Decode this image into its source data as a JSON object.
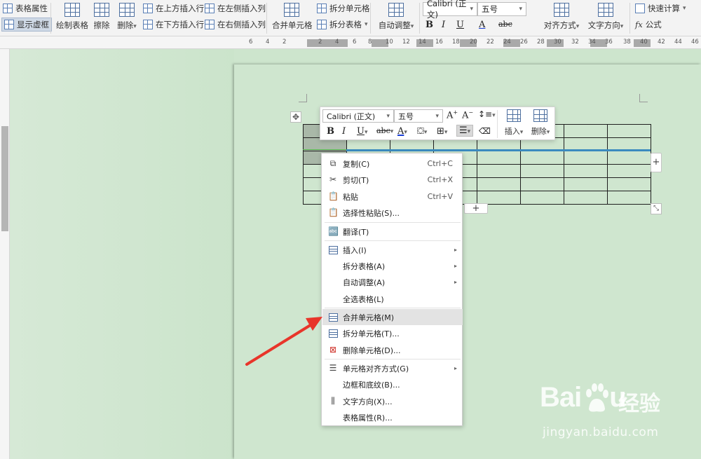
{
  "ribbon": {
    "table_properties": "表格属性",
    "show_gridlines": "显示虚框",
    "draw_table": "绘制表格",
    "eraser": "擦除",
    "delete": "删除",
    "insert_row_above": "在上方插入行",
    "insert_row_below": "在下方插入行",
    "insert_col_left": "在左侧插入列",
    "insert_col_right": "在右侧插入列",
    "merge_cells": "合并单元格",
    "split_cells": "拆分单元格",
    "split_table": "拆分表格",
    "auto_fit": "自动调整",
    "font_name": "Calibri (正文)",
    "font_size": "五号",
    "align": "对齐方式",
    "text_direction": "文字方向",
    "quick_calc": "快速计算",
    "formula": "公式",
    "bold": "B",
    "italic": "I",
    "underline": "U",
    "font_color": "A",
    "strikethrough": "abc"
  },
  "ruler": {
    "numbers": [
      "6",
      "4",
      "2",
      "2",
      "4",
      "6",
      "8",
      "10",
      "12",
      "14",
      "16",
      "18",
      "20",
      "22",
      "24",
      "26",
      "28",
      "30",
      "32",
      "34",
      "36",
      "38",
      "40",
      "42",
      "44",
      "46"
    ]
  },
  "mini_toolbar": {
    "font_name": "Calibri (正文)",
    "font_size": "五号",
    "grow_font": "A",
    "shrink_font": "A",
    "bold": "B",
    "italic": "I",
    "underline": "U",
    "strike": "abc",
    "font_color": "A",
    "insert": "插入",
    "delete": "删除"
  },
  "context_menu": {
    "items": [
      {
        "label": "复制(C)",
        "shortcut": "Ctrl+C",
        "icon": "copy-icon"
      },
      {
        "label": "剪切(T)",
        "shortcut": "Ctrl+X",
        "icon": "cut-icon"
      },
      {
        "label": "粘贴",
        "shortcut": "Ctrl+V",
        "icon": "paste-icon"
      },
      {
        "label": "选择性粘贴(S)...",
        "shortcut": "",
        "icon": "paste-special-icon"
      },
      {
        "label": "翻译(T)",
        "shortcut": "",
        "icon": "translate-icon"
      },
      {
        "label": "插入(I)",
        "shortcut": "",
        "icon": "insert-table-icon"
      },
      {
        "label": "拆分表格(A)",
        "shortcut": "",
        "icon": ""
      },
      {
        "label": "自动调整(A)",
        "shortcut": "",
        "icon": ""
      },
      {
        "label": "全选表格(L)",
        "shortcut": "",
        "icon": ""
      },
      {
        "label": "合并单元格(M)",
        "shortcut": "",
        "icon": "merge-cells-icon"
      },
      {
        "label": "拆分单元格(T)...",
        "shortcut": "",
        "icon": "split-cells-icon"
      },
      {
        "label": "删除单元格(D)...",
        "shortcut": "",
        "icon": "delete-cells-icon"
      },
      {
        "label": "单元格对齐方式(G)",
        "shortcut": "",
        "icon": "cell-align-icon"
      },
      {
        "label": "边框和底纹(B)...",
        "shortcut": "",
        "icon": ""
      },
      {
        "label": "文字方向(X)...",
        "shortcut": "",
        "icon": "text-direction-icon"
      },
      {
        "label": "表格属性(R)...",
        "shortcut": "",
        "icon": ""
      }
    ],
    "highlighted": "合并单元格(M)"
  },
  "watermark": {
    "brand": "Bai",
    "brand_tail": "u",
    "cn": "经验",
    "url": "jingyan.baidu.com"
  },
  "colors": {
    "canvas": "#cde5cd",
    "accent_red": "#e8352a",
    "selection_blue": "#3b8bbf"
  }
}
